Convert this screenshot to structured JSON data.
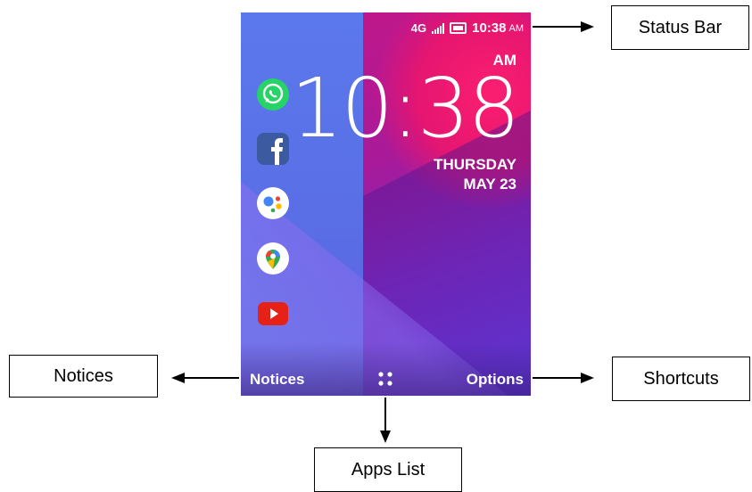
{
  "status_bar": {
    "network": "4G",
    "time": "10:38",
    "ampm": "AM"
  },
  "clock": {
    "ampm": "AM",
    "time": "10:38",
    "day": "THURSDAY",
    "date": "MAY 23"
  },
  "apps": [
    {
      "name": "WhatsApp",
      "icon": "whatsapp-icon",
      "color": "#25d366"
    },
    {
      "name": "Facebook",
      "icon": "facebook-icon",
      "color": "#3b5aa0"
    },
    {
      "name": "Google Assistant",
      "icon": "google-assistant-icon",
      "color": "#ffffff"
    },
    {
      "name": "Google Maps",
      "icon": "google-maps-icon",
      "color": "#ffffff"
    },
    {
      "name": "YouTube",
      "icon": "youtube-icon",
      "color": "#e62117"
    }
  ],
  "softkeys": {
    "left": "Notices",
    "center_icon": "apps-grid-icon",
    "right": "Options"
  },
  "annotations": {
    "status_bar": "Status Bar",
    "notices": "Notices",
    "shortcuts": "Shortcuts",
    "apps_list": "Apps List"
  },
  "colors": {
    "screen_blue": "#5b78ec",
    "screen_magenta": "#e8156f",
    "screen_purple": "#7a2bc4"
  }
}
